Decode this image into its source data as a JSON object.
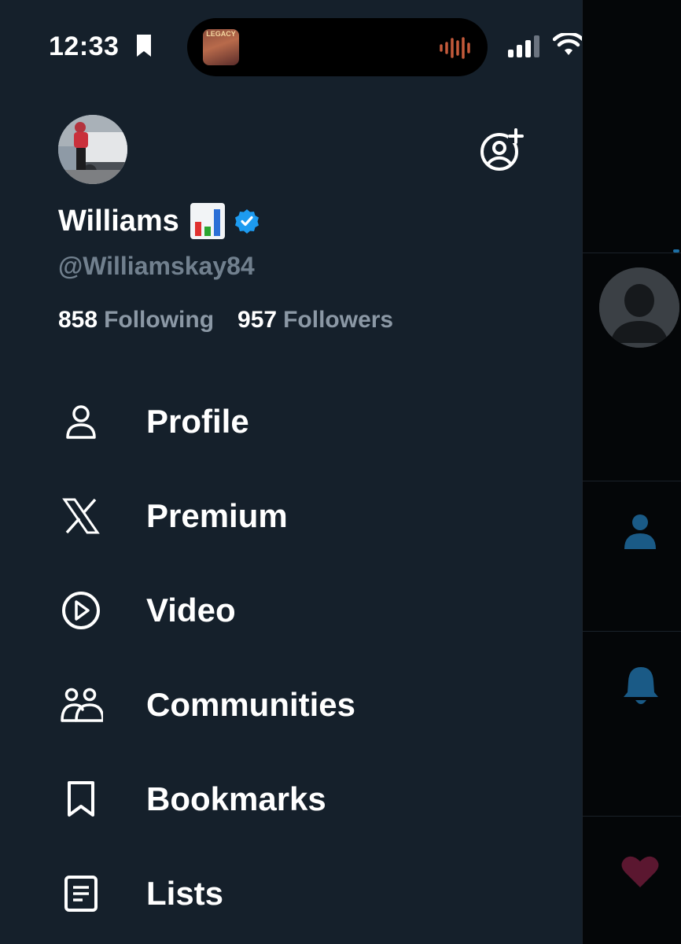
{
  "status_bar": {
    "time": "12:33",
    "now_playing_art_text": "LEGACY"
  },
  "profile": {
    "display_name": "Williams",
    "handle": "@Williamskay84",
    "following_count": "858",
    "following_label": "Following",
    "followers_count": "957",
    "followers_label": "Followers"
  },
  "menu": {
    "items": [
      {
        "label": "Profile",
        "icon": "person-icon"
      },
      {
        "label": "Premium",
        "icon": "x-logo-icon"
      },
      {
        "label": "Video",
        "icon": "play-circle-icon"
      },
      {
        "label": "Communities",
        "icon": "communities-icon"
      },
      {
        "label": "Bookmarks",
        "icon": "bookmark-icon"
      },
      {
        "label": "Lists",
        "icon": "list-icon"
      }
    ]
  },
  "colors": {
    "drawer_bg": "#15202b",
    "verified_blue": "#1d9bf0",
    "muted_text": "#8b98a5",
    "tab_blue": "#1d6fa5",
    "heart": "#5b1730"
  }
}
